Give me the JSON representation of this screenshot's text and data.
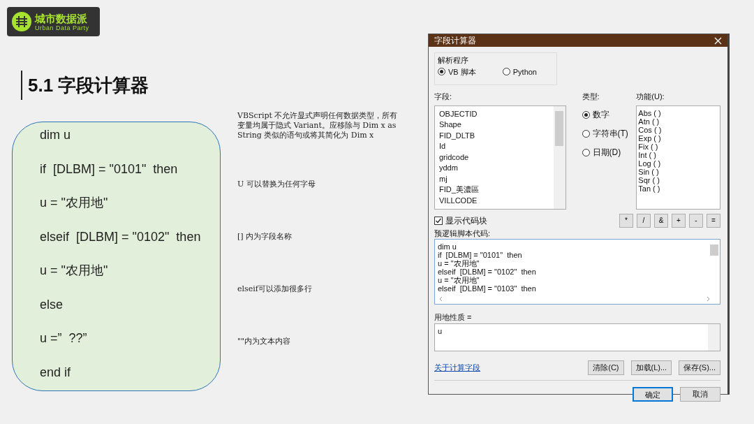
{
  "logo": {
    "title": "城市数据派",
    "subtitle": "Urban Data Party"
  },
  "heading": "5.1 字段计算器",
  "code_lines": [
    "dim u",
    "if  [DLBM] = \"0101\"  then",
    "u = \"农用地\"",
    "elseif  [DLBM] = \"0102\"  then",
    "u = \"农用地\"",
    "else",
    "u =”  ??”",
    "end if"
  ],
  "notes": [
    "VBScript 不允许显式声明任何数据类型，所有变量均属于隐式 Variant。应移除与 Dim x as String 类似的语句或将其简化为 Dim x",
    "U  可以替换为任何字母",
    "[]  内为字段名称",
    "elseif可以添加很多行",
    "\"\"内为文本内容"
  ],
  "dialog": {
    "title": "字段计算器",
    "parser": {
      "label": "解析程序",
      "options": [
        {
          "label": "VB 脚本",
          "selected": true
        },
        {
          "label": "Python",
          "selected": false
        }
      ]
    },
    "fields": {
      "label": "字段:",
      "items": [
        "OBJECTID",
        "Shape",
        "FID_DLTB",
        "Id",
        "gridcode",
        "yddm",
        "mj",
        "FID_美濃區",
        "VILLCODE"
      ]
    },
    "type": {
      "label": "类型:",
      "options": [
        {
          "label": "数字",
          "selected": true
        },
        {
          "label": "字符串(T)",
          "selected": false
        },
        {
          "label": "日期(D)",
          "selected": false
        }
      ]
    },
    "functions": {
      "label": "功能(U):",
      "items": [
        "Abs ( )",
        "Atn ( )",
        "Cos ( )",
        "Exp ( )",
        "Fix ( )",
        "Int ( )",
        "Log ( )",
        "Sin ( )",
        "Sqr ( )",
        "Tan ( )"
      ]
    },
    "show_codeblock": {
      "label": "显示代码块",
      "checked": true
    },
    "operators": [
      "*",
      "/",
      "&",
      "+",
      "-",
      "="
    ],
    "prelogic": {
      "label": "预逻辑脚本代码:",
      "lines": [
        "dim u",
        "if  [DLBM] = \"0101\"  then",
        "u = \"农用地\"",
        "elseif  [DLBM] = \"0102\"  then",
        "u = \"农用地\"",
        "elseif  [DLBM] = \"0103\"  then"
      ]
    },
    "expression": {
      "label": "用地性质 =",
      "value": "u"
    },
    "link": "关于计算字段",
    "tool_buttons": [
      "清除(C)",
      "加载(L)...",
      "保存(S)..."
    ],
    "buttons": [
      "确定",
      "取消"
    ]
  }
}
